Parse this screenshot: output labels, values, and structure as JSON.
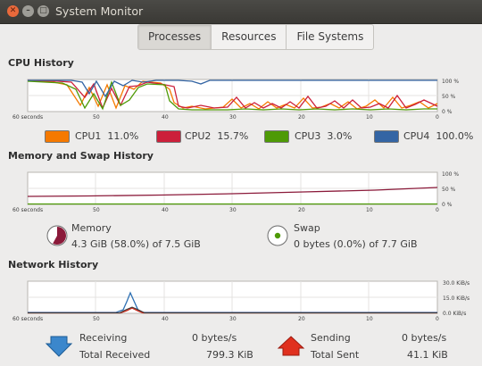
{
  "window": {
    "title": "System Monitor",
    "buttons": {
      "close": "✕",
      "minimize": "–",
      "maximize": "□"
    }
  },
  "tabs": [
    {
      "label": "Processes",
      "active": true
    },
    {
      "label": "Resources",
      "active": false
    },
    {
      "label": "File Systems",
      "active": false
    }
  ],
  "cpu": {
    "heading": "CPU History",
    "x_labels": [
      "60 seconds",
      "50",
      "40",
      "30",
      "20",
      "10",
      "0"
    ],
    "y_labels": [
      "100 %",
      "50 %",
      "0 %"
    ],
    "legend": [
      {
        "label": "CPU1",
        "value": "11.0%",
        "color": "#f57900"
      },
      {
        "label": "CPU2",
        "value": "15.7%",
        "color": "#cc1f3a"
      },
      {
        "label": "CPU3",
        "value": "3.0%",
        "color": "#4e9a06"
      },
      {
        "label": "CPU4",
        "value": "100.0%",
        "color": "#3465a4"
      }
    ]
  },
  "memory": {
    "heading": "Memory and Swap History",
    "x_labels": [
      "60 seconds",
      "50",
      "40",
      "30",
      "20",
      "10",
      "0"
    ],
    "y_labels": [
      "100 %",
      "50 %",
      "0 %"
    ],
    "mem_label": "Memory",
    "mem_value": "4.3 GiB (58.0%) of 7.5 GiB",
    "mem_color": "#8b1a3a",
    "mem_fraction": 0.58,
    "swap_label": "Swap",
    "swap_value": "0 bytes (0.0%) of 7.7 GiB",
    "swap_color": "#4e9a06"
  },
  "network": {
    "heading": "Network History",
    "x_labels": [
      "60 seconds",
      "50",
      "40",
      "30",
      "20",
      "10",
      "0"
    ],
    "y_labels": [
      "30.0 KiB/s",
      "15.0 KiB/s",
      "0.0 KiB/s"
    ],
    "receiving_label": "Receiving",
    "receiving_value": "0 bytes/s",
    "total_received_label": "Total Received",
    "total_received_value": "799.3 KiB",
    "sending_label": "Sending",
    "sending_value": "0 bytes/s",
    "total_sent_label": "Total Sent",
    "total_sent_value": "41.1 KiB",
    "receive_color": "#2c6fb3",
    "send_color": "#cc2a1a"
  }
}
